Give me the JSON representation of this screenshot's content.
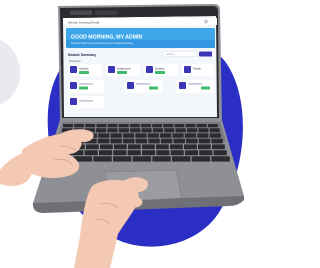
{
  "colors": {
    "backdrop_blob": "#2a2ec4",
    "backdrop_edge": "#e9e9ef",
    "laptop_body": "#8e9096",
    "laptop_bezel": "#2c2c30",
    "keyboard_deck": "#7a7c82",
    "key": "#2b2c30",
    "trackpad": "#9a9ca2",
    "skin": "#f3c9b4",
    "skin_shadow": "#dba58e",
    "app_banner": "#3ea7ea",
    "app_banner_dark": "#1f7fd1",
    "app_accent": "#3a36b7",
    "badge_green": "#3dbb6b",
    "page_bg": "#f3f6fb"
  },
  "screen": {
    "browser_title": "Service Learning Portal",
    "banner_title": "GOOD MORNING, MY ADMIN",
    "banner_subtitle": "Welcome back! Here is an overview of your dashboard today",
    "search_placeholder": "Search...",
    "section_title": "Module Summary",
    "subsection_title": "Overview",
    "tiles": [
      {
        "name": "Activities",
        "count": "100"
      },
      {
        "name": "Assignments",
        "count": "100"
      },
      {
        "name": "Students",
        "count": "100"
      },
      {
        "name": "Faculty",
        "count": "100"
      }
    ]
  }
}
